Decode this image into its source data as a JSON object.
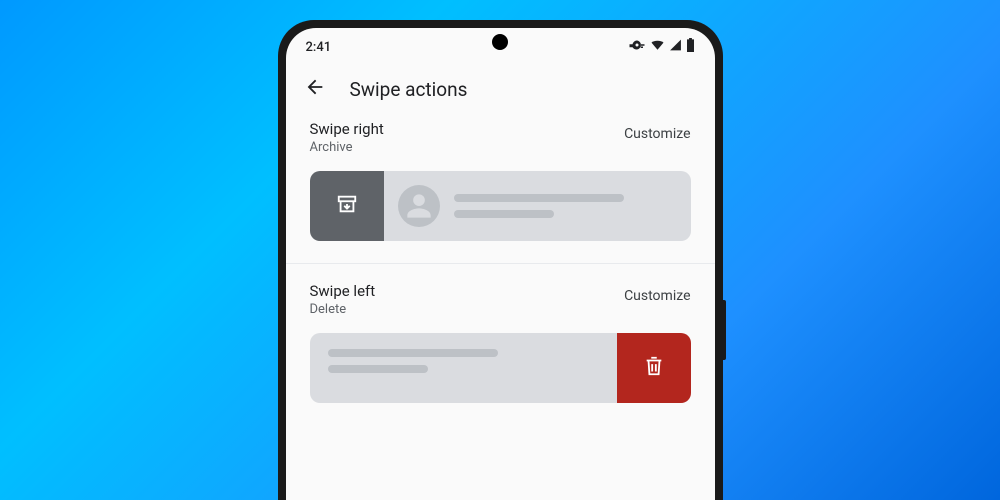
{
  "statusBar": {
    "time": "2:41"
  },
  "page": {
    "title": "Swipe actions"
  },
  "swipeRight": {
    "title": "Swipe right",
    "action": "Archive",
    "customize": "Customize"
  },
  "swipeLeft": {
    "title": "Swipe left",
    "action": "Delete",
    "customize": "Customize"
  }
}
